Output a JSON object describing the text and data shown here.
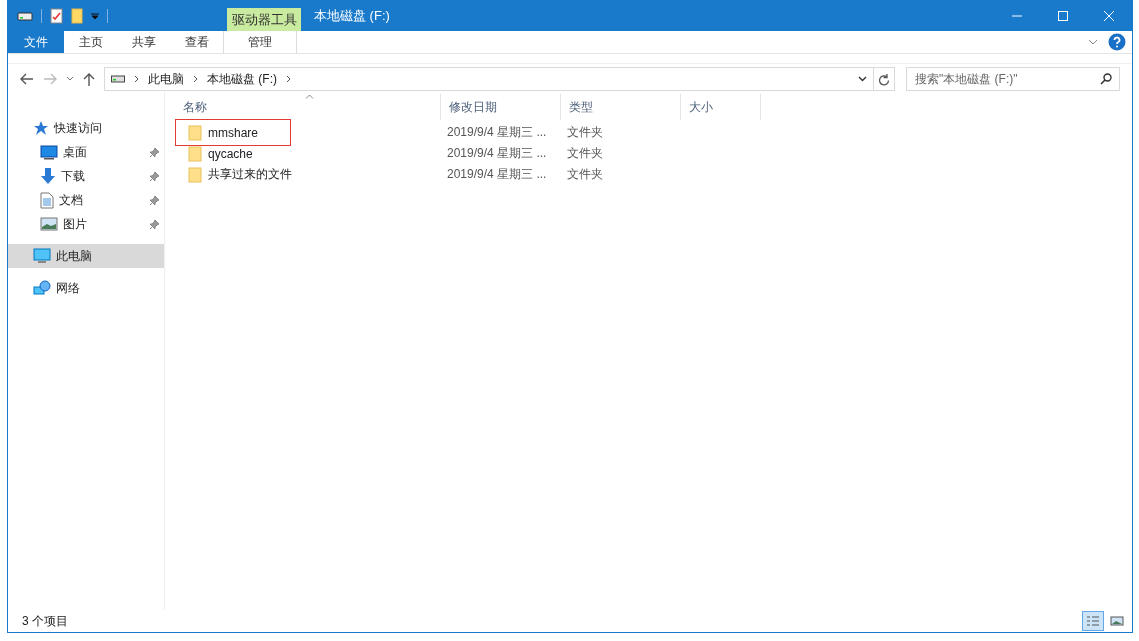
{
  "window": {
    "title": "本地磁盘 (F:)",
    "context_tab": "驱动器工具"
  },
  "ribbon_tabs": [
    {
      "label": "文件",
      "kind": "file",
      "selected": false
    },
    {
      "label": "主页",
      "kind": "tab",
      "selected": false
    },
    {
      "label": "共享",
      "kind": "tab",
      "selected": false
    },
    {
      "label": "查看",
      "kind": "tab",
      "selected": false
    },
    {
      "label": "管理",
      "kind": "context",
      "selected": false
    }
  ],
  "address": {
    "crumbs": [
      "此电脑",
      "本地磁盘 (F:)"
    ]
  },
  "search": {
    "placeholder": "搜索\"本地磁盘 (F:)\""
  },
  "sidebar": {
    "items": [
      {
        "label": "快速访问",
        "kind": "quick",
        "selected": false,
        "children": [
          {
            "label": "桌面",
            "kind": "desktop",
            "pinned": true,
            "selected": false
          },
          {
            "label": "下载",
            "kind": "download",
            "pinned": true,
            "selected": false
          },
          {
            "label": "文档",
            "kind": "document",
            "pinned": true,
            "selected": false
          },
          {
            "label": "图片",
            "kind": "picture",
            "pinned": true,
            "selected": false
          }
        ]
      },
      {
        "label": "此电脑",
        "kind": "pc",
        "selected": true
      },
      {
        "label": "网络",
        "kind": "network",
        "selected": false
      }
    ]
  },
  "table": {
    "columns": [
      "名称",
      "修改日期",
      "类型",
      "大小"
    ],
    "rows": [
      {
        "name": "mmshare",
        "date": "2019/9/4 星期三 ...",
        "type": "文件夹",
        "highlighted": true
      },
      {
        "name": "qycache",
        "date": "2019/9/4 星期三 ...",
        "type": "文件夹",
        "highlighted": false
      },
      {
        "name": "共享过来的文件",
        "date": "2019/9/4 星期三 ...",
        "type": "文件夹",
        "highlighted": false
      }
    ]
  },
  "status_bar": {
    "count": "3 个项目",
    "views": [
      {
        "kind": "details",
        "selected": true
      },
      {
        "kind": "thumbnails",
        "selected": false
      }
    ]
  }
}
